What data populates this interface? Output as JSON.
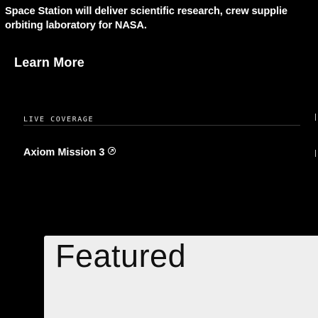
{
  "hero": {
    "description_line1": "Space Station will deliver scientific research, crew supplie",
    "description_line2": "orbiting laboratory for NASA.",
    "learn_more_label": "Learn More"
  },
  "coverage": {
    "section_label": "LIVE COVERAGE",
    "link_label": "Axiom Mission 3",
    "link_icon": "arrow-circle-icon"
  },
  "featured": {
    "title": "Featured",
    "panel_color": "#eeeeee"
  },
  "colors": {
    "background": "#000000",
    "text": "#ffffff"
  }
}
